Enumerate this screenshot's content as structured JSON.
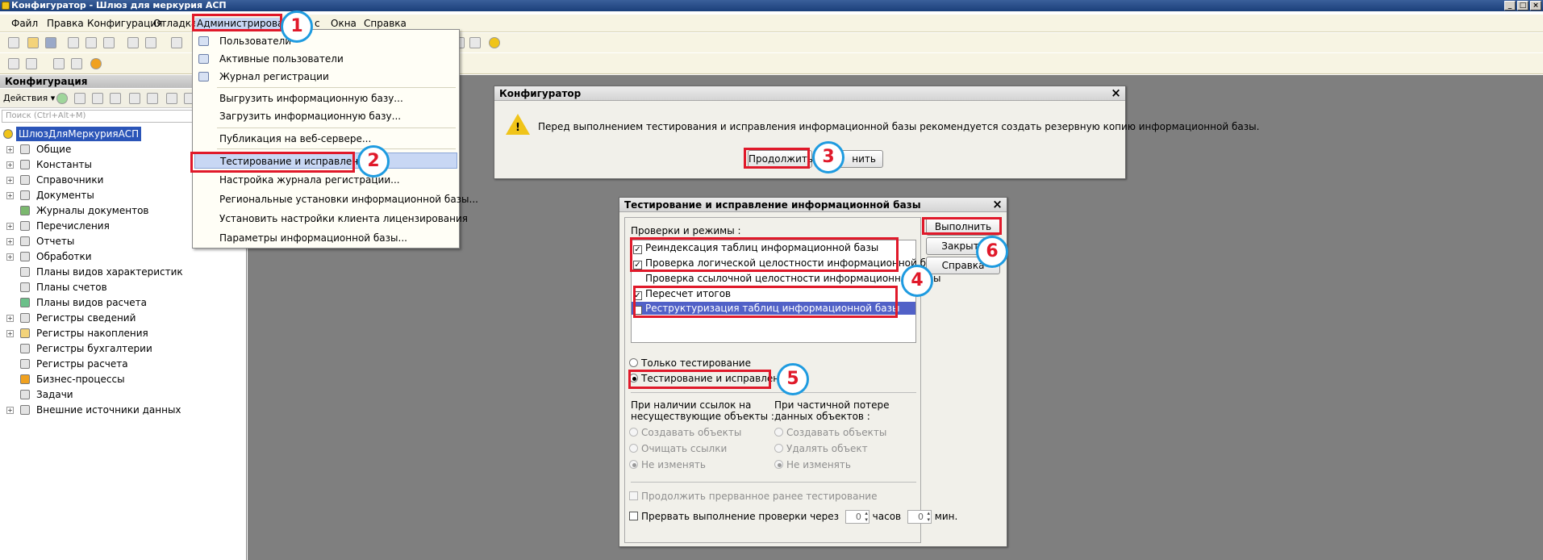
{
  "window": {
    "title": "Конфигуратор - Шлюз для меркурия АСП",
    "btn_minimize": "_",
    "btn_maximize": "□",
    "btn_close": "×"
  },
  "menubar": {
    "items": [
      "Файл",
      "Правка",
      "Конфигурация",
      "Отладка",
      "Администрирование",
      "с",
      "Окна",
      "Справка"
    ]
  },
  "left_pane": {
    "title": "Конфигурация",
    "actions_label": "Действия ▾",
    "search_placeholder": "Поиск (Ctrl+Alt+M)",
    "root": "ШлюзДляМеркурияАСП",
    "items": [
      "Общие",
      "Константы",
      "Справочники",
      "Документы",
      "Журналы документов",
      "Перечисления",
      "Отчеты",
      "Обработки",
      "Планы видов характеристик",
      "Планы счетов",
      "Планы видов расчета",
      "Регистры сведений",
      "Регистры накопления",
      "Регистры бухгалтерии",
      "Регистры расчета",
      "Бизнес-процессы",
      "Задачи",
      "Внешние источники данных"
    ]
  },
  "admin_menu": {
    "items": [
      "Пользователи",
      "Активные пользователи",
      "Журнал регистрации",
      "Выгрузить информационную базу...",
      "Загрузить информационную базу...",
      "Публикация на веб-сервере...",
      "Тестирование и исправление...",
      "Настройка журнала регистрации...",
      "Региональные установки информационной базы...",
      "Установить настройки клиента лицензирования",
      "Параметры информационной базы..."
    ]
  },
  "warning_dialog": {
    "title": "Конфигуратор",
    "message": "Перед выполнением тестирования и исправления информационной базы рекомендуется создать резервную копию информационной базы.",
    "continue_label": "Продолжить",
    "cancel_label": "нить",
    "warning_glyph": "!"
  },
  "test_dialog": {
    "title": "Тестирование и исправление информационной базы",
    "checks_label": "Проверки и режимы :",
    "checks": [
      {
        "label": "Реиндексация таблиц информационной базы",
        "checked": true
      },
      {
        "label": "Проверка логической целостности информационной базы",
        "checked": true
      },
      {
        "label": "Проверка ссылочной целостности информационной базы",
        "checked": false
      },
      {
        "label": "Пересчет итогов",
        "checked": true
      },
      {
        "label": "Реструктуризация таблиц информационной базы",
        "checked": true
      }
    ],
    "mode_test_only": "Только тестирование",
    "mode_test_fix": "Тестирование и исправление",
    "refs_title_1": "При наличии ссылок на",
    "refs_title_2": "несуществующие объекты :",
    "refs_opts": [
      "Создавать объекты",
      "Очищать ссылки",
      "Не изменять"
    ],
    "loss_title_1": "При частичной потере",
    "loss_title_2": "данных объектов :",
    "loss_opts": [
      "Создавать объекты",
      "Удалять объект",
      "Не изменять"
    ],
    "continue_interrupted": "Продолжить прерванное ранее тестирование",
    "interrupt_label": "Прервать выполнение проверки через",
    "hours_value": "0",
    "hours_label": "часов",
    "minutes_value": "0",
    "minutes_label": "мин.",
    "btn_run": "Выполнить",
    "btn_close": "Закрыть",
    "btn_help": "Справка"
  },
  "badges": [
    "1",
    "2",
    "3",
    "4",
    "5",
    "6"
  ],
  "colors": {
    "annotation_red": "#e0192a",
    "annotation_blue": "#1e9be0",
    "selection_blue": "#2b55b8"
  }
}
